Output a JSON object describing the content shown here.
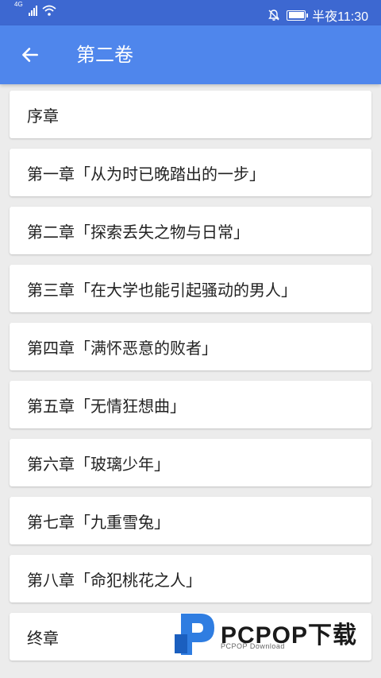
{
  "status_bar": {
    "network": "4G",
    "time": "半夜11:30"
  },
  "header": {
    "title": "第二卷",
    "back_icon": "arrow-left-icon"
  },
  "chapters": [
    {
      "title": "序章"
    },
    {
      "title": "第一章「从为时已晚踏出的一步」"
    },
    {
      "title": "第二章「探索丢失之物与日常」"
    },
    {
      "title": "第三章「在大学也能引起骚动的男人」"
    },
    {
      "title": "第四章「满怀恶意的败者」"
    },
    {
      "title": "第五章「无情狂想曲」"
    },
    {
      "title": "第六章「玻璃少年」"
    },
    {
      "title": "第七章「九重雪兔」"
    },
    {
      "title": "第八章「命犯桃花之人」"
    },
    {
      "title": "终章"
    }
  ],
  "watermark": {
    "brand": "PCPOP下载",
    "sub": "PCPOP Download"
  },
  "colors": {
    "status_bar": "#3d68d1",
    "app_bar": "#4f86ec",
    "background": "#ececec",
    "card": "#ffffff"
  }
}
